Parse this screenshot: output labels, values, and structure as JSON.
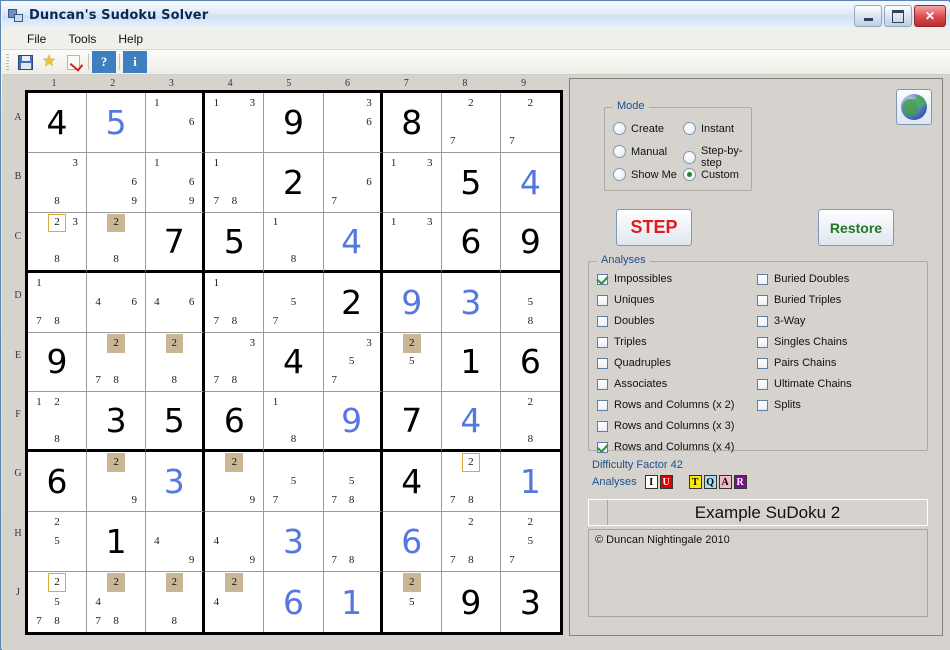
{
  "window": {
    "title": "Duncan's Sudoku Solver",
    "minimize_label": "Minimize",
    "maximize_label": "Maximize",
    "close_label": "✕"
  },
  "menu": {
    "items": [
      "File",
      "Tools",
      "Help"
    ]
  },
  "toolbar": {
    "buttons": [
      {
        "name": "save-icon",
        "glyph": ""
      },
      {
        "name": "favorite-star-icon",
        "glyph": "★"
      },
      {
        "name": "check-page-icon",
        "glyph": ""
      },
      {
        "name": "help-question-button",
        "glyph": "?"
      },
      {
        "name": "info-button",
        "glyph": "i"
      }
    ]
  },
  "board": {
    "column_headers": [
      "1",
      "2",
      "3",
      "4",
      "5",
      "6",
      "7",
      "8",
      "9"
    ],
    "row_headers": [
      "A",
      "B",
      "C",
      "D",
      "E",
      "F",
      "G",
      "H",
      "J"
    ],
    "cells": [
      [
        {
          "value": "4"
        },
        {
          "value": "5",
          "solved": true
        },
        {
          "pencil": {
            "1": "1",
            "6": "6"
          }
        },
        {
          "pencil": {
            "1": "1",
            "3": "3"
          }
        },
        {
          "value": "9"
        },
        {
          "pencil": {
            "3": "3",
            "6": "6"
          }
        },
        {
          "value": "8"
        },
        {
          "pencil": {
            "2": "2",
            "7": "7"
          }
        },
        {
          "pencil": {
            "2": "2",
            "7": "7"
          }
        }
      ],
      [
        {
          "pencil": {
            "3": "3",
            "8": "8"
          }
        },
        {
          "pencil": {
            "6": "6",
            "9": "9"
          }
        },
        {
          "pencil": {
            "1": "1",
            "6": "6",
            "9": "9"
          }
        },
        {
          "pencil": {
            "1": "1",
            "7": "7",
            "8": "8"
          }
        },
        {
          "value": "2"
        },
        {
          "pencil": {
            "6": "6",
            "7": "7"
          }
        },
        {
          "pencil": {
            "1": "1",
            "3": "3"
          }
        },
        {
          "value": "5"
        },
        {
          "value": "4",
          "solved": true
        }
      ],
      [
        {
          "pencil": {
            "2": "2",
            "3": "3",
            "8": "8"
          },
          "marks": {
            "2": "box"
          }
        },
        {
          "pencil": {
            "2": "2",
            "8": "8"
          },
          "marks": {
            "2": "hl"
          }
        },
        {
          "value": "7"
        },
        {
          "value": "5"
        },
        {
          "pencil": {
            "1": "1",
            "8": "8"
          }
        },
        {
          "value": "4",
          "solved": true
        },
        {
          "pencil": {
            "1": "1",
            "3": "3"
          }
        },
        {
          "value": "6"
        },
        {
          "value": "9"
        }
      ],
      [
        {
          "pencil": {
            "1": "1",
            "7": "7",
            "8": "8"
          }
        },
        {
          "pencil": {
            "4": "4",
            "6": "6"
          }
        },
        {
          "pencil": {
            "4": "4",
            "6": "6"
          }
        },
        {
          "pencil": {
            "1": "1",
            "7": "7",
            "8": "8"
          }
        },
        {
          "pencil": {
            "5": "5",
            "7": "7"
          }
        },
        {
          "value": "2"
        },
        {
          "value": "9",
          "solved": true
        },
        {
          "value": "3",
          "solved": true
        },
        {
          "pencil": {
            "5": "5",
            "8": "8"
          }
        }
      ],
      [
        {
          "value": "9"
        },
        {
          "pencil": {
            "2": "2",
            "7": "7",
            "8": "8"
          },
          "marks": {
            "2": "hl"
          }
        },
        {
          "pencil": {
            "2": "2",
            "8": "8"
          },
          "marks": {
            "2": "hl"
          }
        },
        {
          "pencil": {
            "3": "3",
            "7": "7",
            "8": "8"
          }
        },
        {
          "value": "4"
        },
        {
          "pencil": {
            "3": "3",
            "5": "5",
            "7": "7"
          }
        },
        {
          "pencil": {
            "2": "2",
            "5": "5"
          },
          "marks": {
            "2": "hl"
          }
        },
        {
          "value": "1"
        },
        {
          "value": "6"
        }
      ],
      [
        {
          "pencil": {
            "1": "1",
            "2": "2",
            "8": "8"
          }
        },
        {
          "value": "3"
        },
        {
          "value": "5"
        },
        {
          "value": "6"
        },
        {
          "pencil": {
            "1": "1",
            "8": "8"
          }
        },
        {
          "value": "9",
          "solved": true
        },
        {
          "value": "7"
        },
        {
          "value": "4",
          "solved": true
        },
        {
          "pencil": {
            "2": "2",
            "8": "8"
          }
        }
      ],
      [
        {
          "value": "6"
        },
        {
          "pencil": {
            "2": "2",
            "9": "9"
          },
          "marks": {
            "2": "hl"
          }
        },
        {
          "value": "3",
          "solved": true
        },
        {
          "pencil": {
            "2": "2",
            "9": "9"
          },
          "marks": {
            "2": "hl"
          }
        },
        {
          "pencil": {
            "5": "5",
            "7": "7"
          }
        },
        {
          "pencil": {
            "5": "5",
            "7": "7",
            "8": "8"
          }
        },
        {
          "value": "4"
        },
        {
          "pencil": {
            "2": "2",
            "7": "7",
            "8": "8"
          },
          "marks": {
            "2": "box"
          }
        },
        {
          "value": "1",
          "solved": true
        }
      ],
      [
        {
          "pencil": {
            "2": "2",
            "5": "5"
          }
        },
        {
          "value": "1"
        },
        {
          "pencil": {
            "4": "4",
            "9": "9"
          }
        },
        {
          "pencil": {
            "4": "4",
            "9": "9"
          }
        },
        {
          "value": "3",
          "solved": true
        },
        {
          "pencil": {
            "7": "7",
            "8": "8"
          }
        },
        {
          "value": "6",
          "solved": true
        },
        {
          "pencil": {
            "2": "2",
            "7": "7",
            "8": "8"
          }
        },
        {
          "pencil": {
            "2": "2",
            "5": "5",
            "7": "7"
          }
        }
      ],
      [
        {
          "pencil": {
            "2": "2",
            "5": "5",
            "7": "7",
            "8": "8"
          },
          "marks": {
            "2": "box"
          }
        },
        {
          "pencil": {
            "2": "2",
            "4": "4",
            "7": "7",
            "8": "8"
          },
          "marks": {
            "2": "hl"
          }
        },
        {
          "pencil": {
            "2": "2",
            "8": "8"
          },
          "marks": {
            "2": "hl"
          }
        },
        {
          "pencil": {
            "2": "2",
            "4": "4"
          },
          "marks": {
            "2": "hl"
          }
        },
        {
          "value": "6",
          "solved": true
        },
        {
          "value": "1",
          "solved": true
        },
        {
          "pencil": {
            "2": "2",
            "5": "5"
          },
          "marks": {
            "2": "hl"
          }
        },
        {
          "value": "9"
        },
        {
          "value": "3"
        }
      ]
    ]
  },
  "panel": {
    "mode": {
      "legend": "Mode",
      "options": [
        {
          "label": "Create",
          "selected": false
        },
        {
          "label": "Instant",
          "selected": false
        },
        {
          "label": "Manual",
          "selected": false
        },
        {
          "label": "Step-by-step",
          "selected": false
        },
        {
          "label": "Show Me",
          "selected": false
        },
        {
          "label": "Custom",
          "selected": true
        }
      ]
    },
    "step_button": "STEP",
    "restore_button": "Restore",
    "globe_button_name": "globe-icon",
    "analyses": {
      "legend": "Analyses",
      "left_column": [
        {
          "label": "Impossibles",
          "checked": true
        },
        {
          "label": "Uniques",
          "checked": false
        },
        {
          "label": "Doubles",
          "checked": false
        },
        {
          "label": "Triples",
          "checked": false
        },
        {
          "label": "Quadruples",
          "checked": false
        },
        {
          "label": "Associates",
          "checked": false
        },
        {
          "label": "Rows and Columns (x 2)",
          "checked": false
        },
        {
          "label": "Rows and Columns (x 3)",
          "checked": false
        },
        {
          "label": "Rows and Columns (x 4)",
          "checked": true
        }
      ],
      "right_column": [
        {
          "label": "Buried Doubles",
          "checked": false
        },
        {
          "label": "Buried Triples",
          "checked": false
        },
        {
          "label": "3-Way",
          "checked": false
        },
        {
          "label": "Singles Chains",
          "checked": false
        },
        {
          "label": "Pairs Chains",
          "checked": false
        },
        {
          "label": "Ultimate Chains",
          "checked": false
        },
        {
          "label": "Splits",
          "checked": false
        }
      ]
    },
    "difficulty_label": "Difficulty Factor 42",
    "analyses_badges_label": "Analyses",
    "badges": [
      {
        "letter": "I",
        "bg": "#ffffff",
        "fg": "#000000",
        "gap": false
      },
      {
        "letter": "U",
        "bg": "#e00000",
        "fg": "#ffffff",
        "gap": false
      },
      {
        "letter": "T",
        "bg": "#ffe800",
        "fg": "#000000",
        "gap": true
      },
      {
        "letter": "Q",
        "bg": "#a6dcf0",
        "fg": "#000000",
        "gap": false
      },
      {
        "letter": "A",
        "bg": "#f4b9c4",
        "fg": "#000000",
        "gap": false
      },
      {
        "letter": "R",
        "bg": "#7b0f8f",
        "fg": "#ffffff",
        "gap": false
      }
    ],
    "puzzle_title": "Example SuDoku 2",
    "notes": "Duncan Nightingale 2010",
    "notes_prefix": "©"
  },
  "colors": {
    "solved_value": "#5577e0",
    "given_value": "#000000",
    "pencil_highlight": "#c9b694",
    "pencil_box_border": "#d9a93a",
    "step_text": "#e01b1b",
    "restore_text": "#1e7a1e",
    "group_legend": "#1d4f8f"
  }
}
